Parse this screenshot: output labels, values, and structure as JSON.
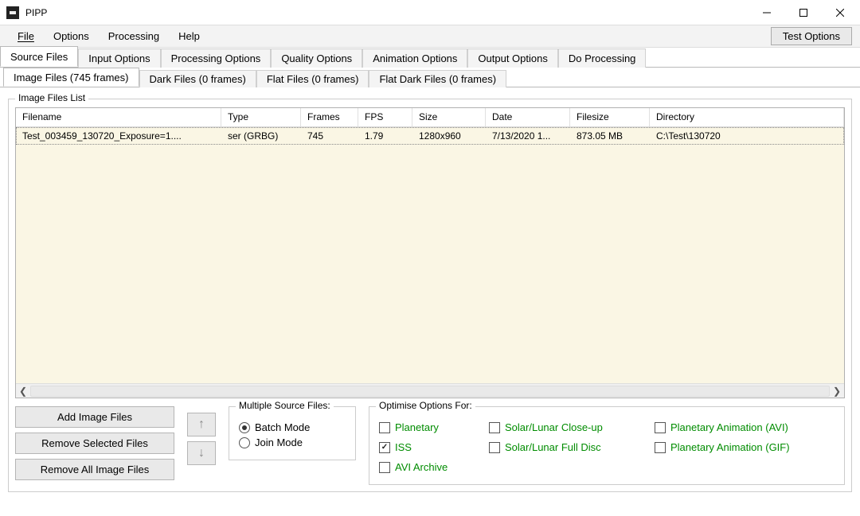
{
  "window": {
    "title": "PIPP"
  },
  "menubar": {
    "items": [
      "File",
      "Options",
      "Processing",
      "Help"
    ],
    "test_options": "Test Options"
  },
  "top_tabs": [
    "Source Files",
    "Input Options",
    "Processing Options",
    "Quality Options",
    "Animation Options",
    "Output Options",
    "Do Processing"
  ],
  "sub_tabs": [
    "Image Files (745 frames)",
    "Dark Files (0 frames)",
    "Flat Files (0 frames)",
    "Flat Dark Files (0 frames)"
  ],
  "group_title": "Image Files List",
  "columns": {
    "filename": "Filename",
    "type": "Type",
    "frames": "Frames",
    "fps": "FPS",
    "size": "Size",
    "date": "Date",
    "filesize": "Filesize",
    "directory": "Directory"
  },
  "rows": [
    {
      "filename": "Test_003459_130720_Exposure=1....",
      "type": "ser (GRBG)",
      "frames": "745",
      "fps": "1.79",
      "size": "1280x960",
      "date": "7/13/2020 1...",
      "filesize": "873.05 MB",
      "directory": "C:\\Test\\130720"
    }
  ],
  "buttons": {
    "add": "Add Image Files",
    "remove_sel": "Remove Selected Files",
    "remove_all": "Remove All Image Files"
  },
  "multiple_src": {
    "title": "Multiple Source Files:",
    "batch": "Batch Mode",
    "join": "Join Mode"
  },
  "optimise": {
    "title": "Optimise Options For:",
    "planetary": "Planetary",
    "iss": "ISS",
    "avi": "AVI Archive",
    "solar_close": "Solar/Lunar Close-up",
    "solar_full": "Solar/Lunar Full Disc",
    "anim_avi": "Planetary Animation (AVI)",
    "anim_gif": "Planetary Animation (GIF)"
  }
}
